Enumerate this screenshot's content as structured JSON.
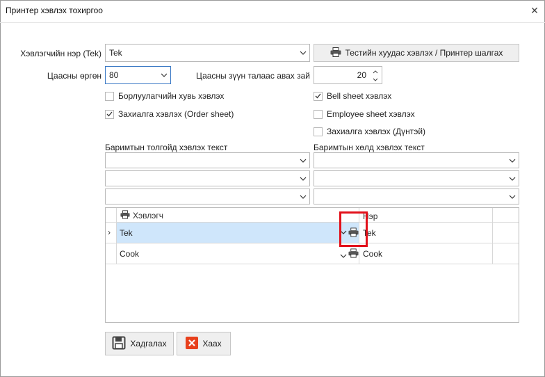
{
  "window": {
    "title": "Принтер хэвлэх тохиргоо"
  },
  "printer_name": {
    "label": "Хэвлэгчийн нэр (Tek)",
    "value": "Tek"
  },
  "test_button": {
    "label": "Тестийн хуудас хэвлэх / Принтер шалгах"
  },
  "paper_width": {
    "label": "Цаасны өргөн",
    "value": "80"
  },
  "margin": {
    "label": "Цаасны зүүн талаас авах зай",
    "value": "20"
  },
  "checkboxes": {
    "vendor_print": {
      "label": "Борлуулагчийн хувь хэвлэх",
      "checked": false
    },
    "bell_sheet": {
      "label": "Bell sheet хэвлэх",
      "checked": true
    },
    "order_sheet": {
      "label": "Захиалга хэвлэх (Order sheet)",
      "checked": true
    },
    "employee_sheet": {
      "label": "Employee sheet хэвлэх",
      "checked": false
    },
    "order_total": {
      "label": "Захиалга хэвлэх (Дүнтэй)",
      "checked": false
    }
  },
  "header_text": {
    "label": "Баримтын толгойд хэвлэх текст",
    "lines": [
      "",
      "",
      ""
    ]
  },
  "footer_text": {
    "label": "Баримтын хөлд хэвлэх текст",
    "lines": [
      "",
      "",
      ""
    ]
  },
  "grid": {
    "columns": [
      "Хэвлэгч",
      "Нэр"
    ],
    "rows": [
      {
        "printer": "Tek",
        "name": "Tek",
        "selected": true
      },
      {
        "printer": "Cook",
        "name": "Cook",
        "selected": false
      }
    ]
  },
  "actions": {
    "save": "Хадгалах",
    "close": "Хаах"
  },
  "colors": {
    "selection": "#cfe6fb",
    "highlight": "#e2101a",
    "close_icon": "#e8401c"
  }
}
